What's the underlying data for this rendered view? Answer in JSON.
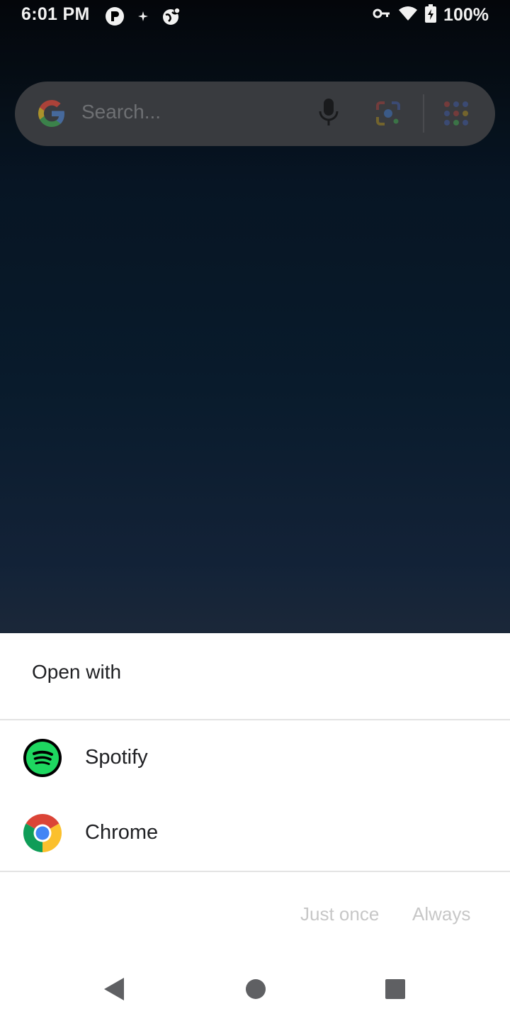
{
  "status_bar": {
    "time": "6:01 PM",
    "battery": "100%",
    "left_icons": [
      "notification-badge-icon",
      "sparkle-icon",
      "globe-icon"
    ],
    "right_icons": [
      "vpn-key-icon",
      "wifi-icon",
      "battery-charging-icon"
    ]
  },
  "search_widget": {
    "placeholder": "Search..."
  },
  "sheet": {
    "title": "Open with",
    "apps": [
      {
        "label": "Spotify",
        "icon": "spotify-icon"
      },
      {
        "label": "Chrome",
        "icon": "chrome-icon"
      }
    ],
    "actions": {
      "just_once": "Just once",
      "always": "Always"
    }
  },
  "nav_bar": {
    "buttons": [
      "back-button",
      "home-button",
      "recents-button"
    ]
  },
  "colors": {
    "spotify_green": "#1ed760",
    "disabled_text": "#c7c7c7",
    "sheet_bg": "#ffffff"
  }
}
